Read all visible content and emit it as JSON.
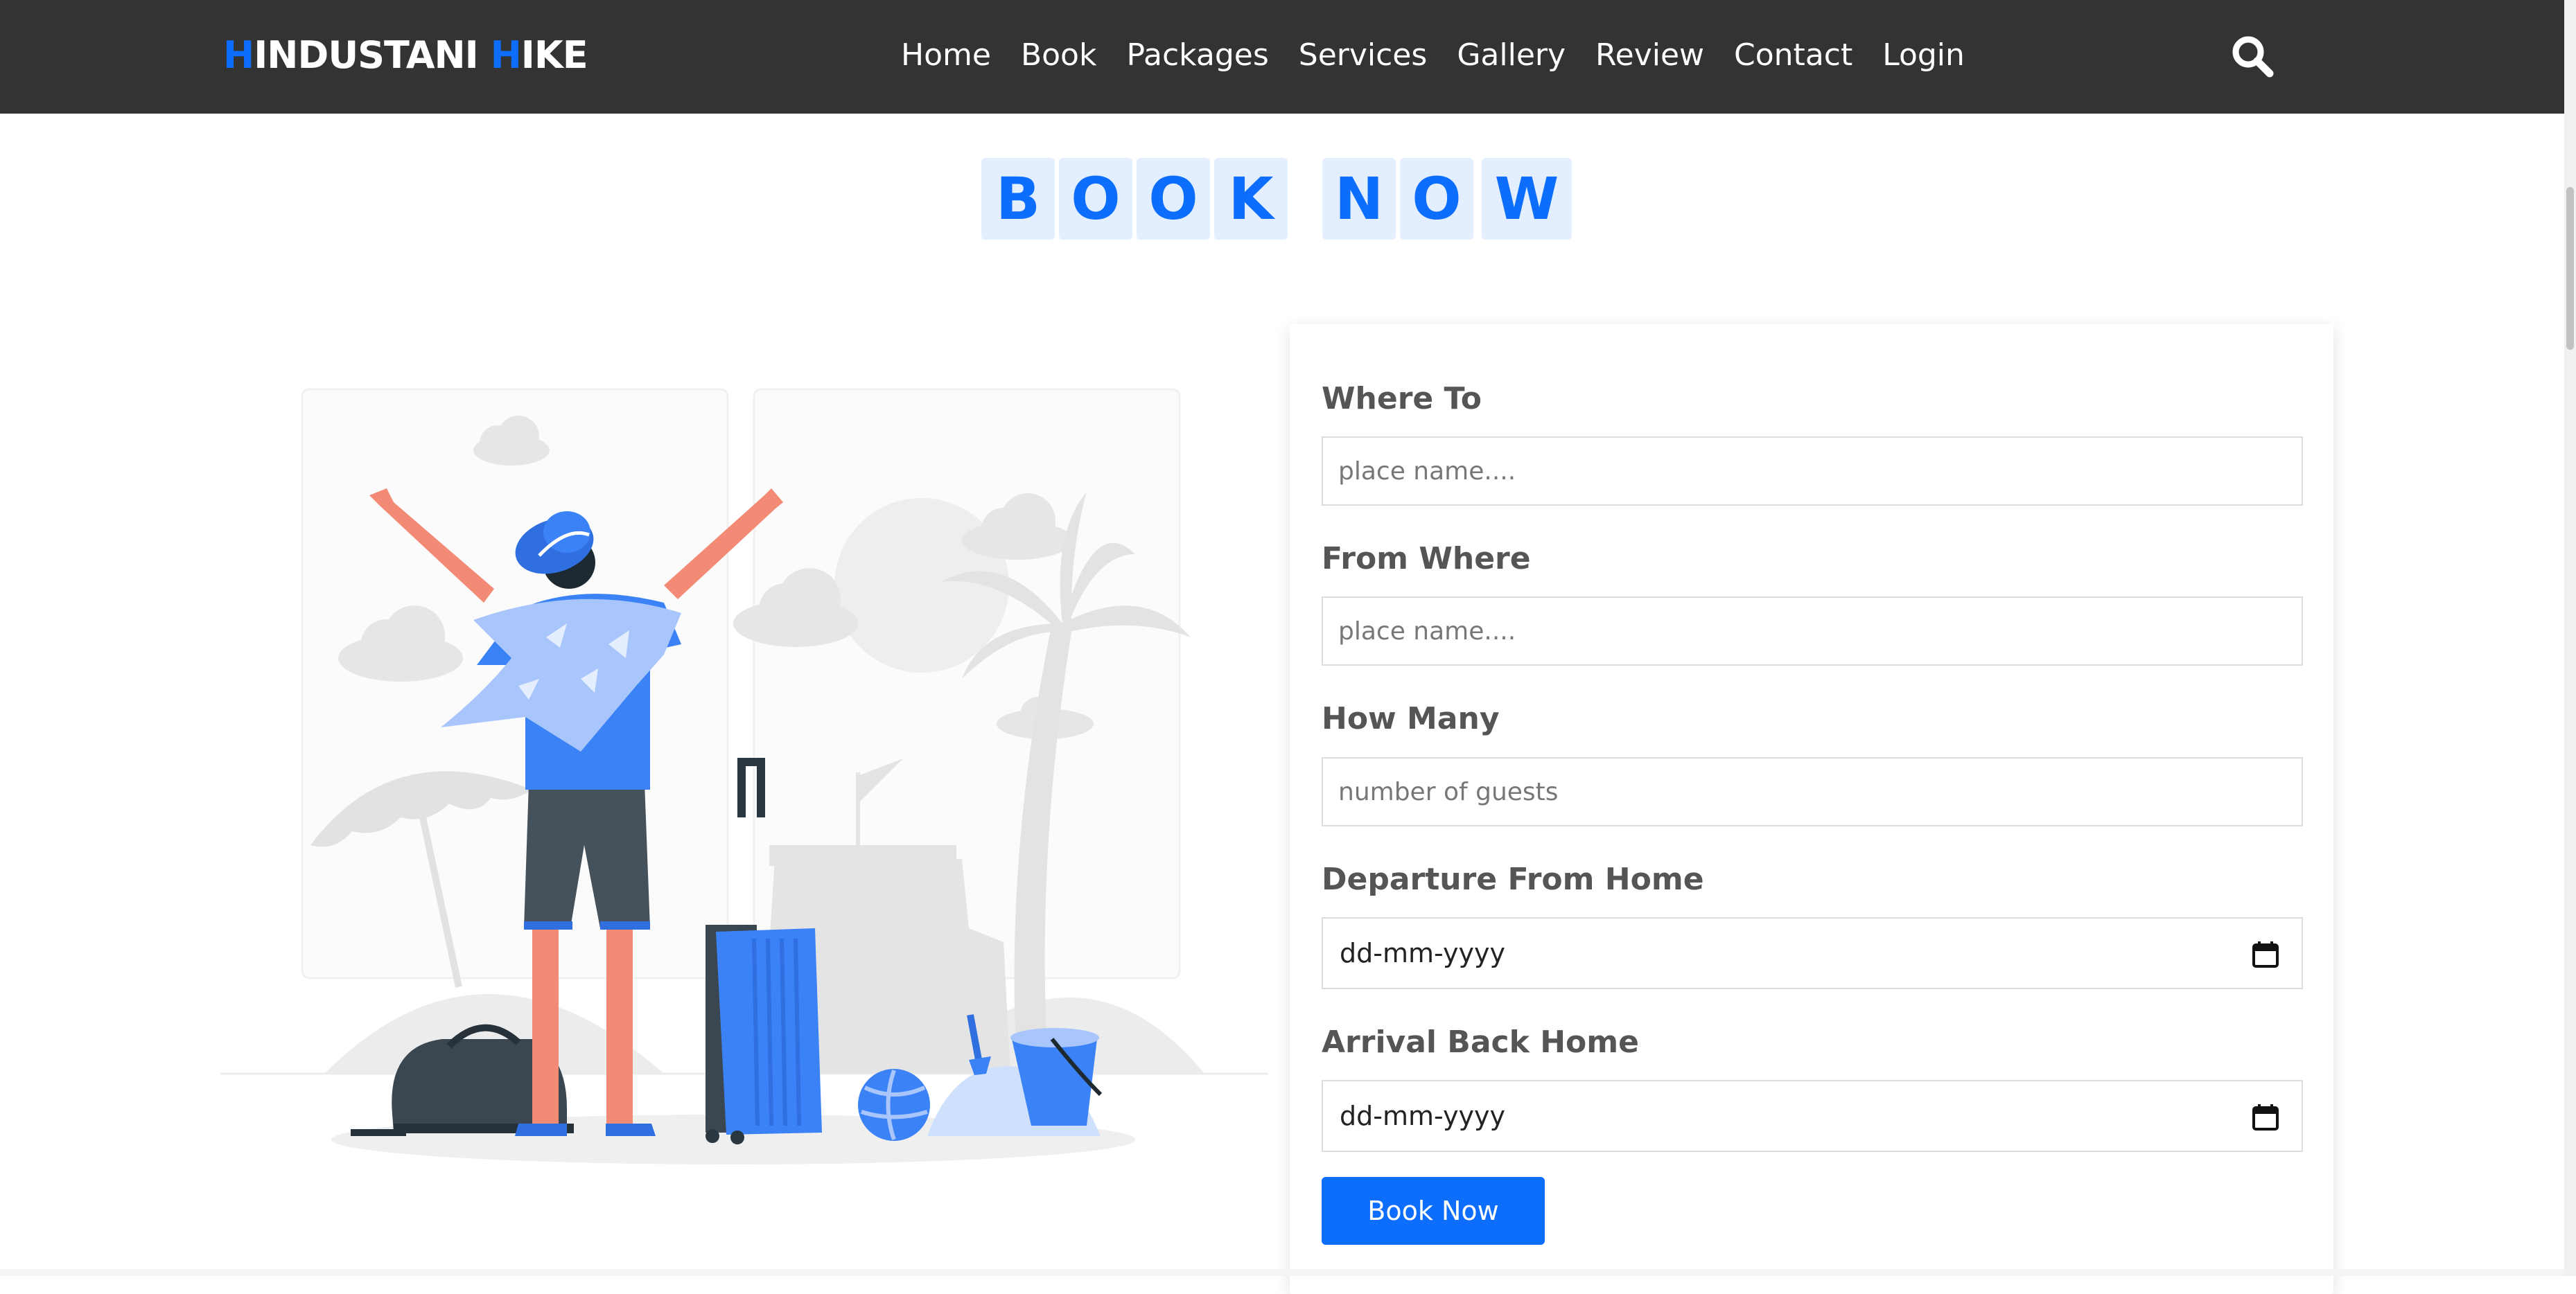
{
  "header": {
    "logo": {
      "first_initial": "H",
      "first_rest": "INDUSTANI ",
      "second_initial": "H",
      "second_rest": "IKE"
    },
    "nav": [
      "Home",
      "Book",
      "Packages",
      "Services",
      "Gallery",
      "Review",
      "Contact",
      "Login"
    ],
    "search_icon": "search-icon"
  },
  "heading": {
    "letters": [
      "B",
      "O",
      "O",
      "K",
      "N",
      "O",
      "W"
    ]
  },
  "form": {
    "where_to": {
      "label": "Where To",
      "placeholder": "place name...."
    },
    "from_where": {
      "label": "From Where",
      "placeholder": "place name...."
    },
    "how_many": {
      "label": "How Many",
      "placeholder": "number of guests"
    },
    "departure": {
      "label": "Departure From Home",
      "value": "dd-mm-yyyy",
      "icon": "calendar-icon"
    },
    "arrival": {
      "label": "Arrival Back Home",
      "value": "dd-mm-yyyy",
      "icon": "calendar-icon"
    },
    "submit_label": "Book Now"
  },
  "colors": {
    "accent": "#0d6efd",
    "header_bg": "#333333",
    "letter_bg": "#e3eeff",
    "label": "#555555"
  }
}
